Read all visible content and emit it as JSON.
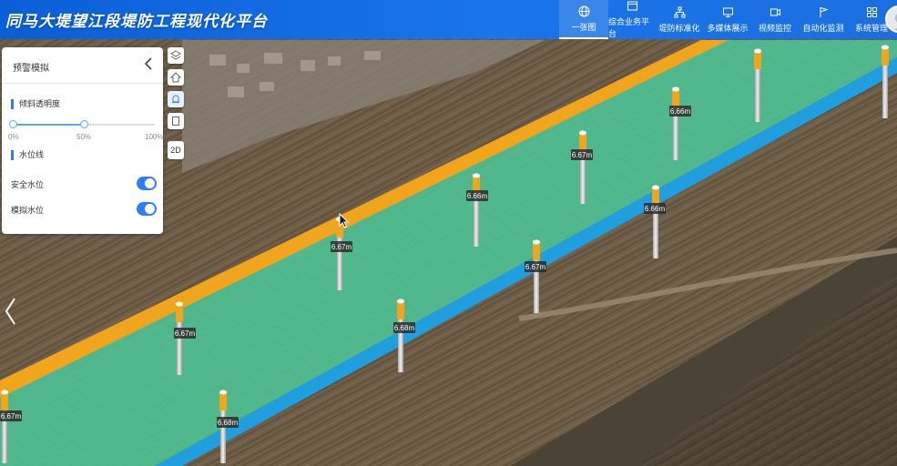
{
  "app": {
    "title": "同马大堤望江段堤防工程现代化平台"
  },
  "nav": {
    "items": [
      {
        "label": "一张图",
        "icon": "globe-icon",
        "active": true
      },
      {
        "label": "综合业务平台",
        "icon": "window-icon",
        "active": false
      },
      {
        "label": "堤防标准化",
        "icon": "hierarchy-icon",
        "active": false
      },
      {
        "label": "多媒体展示",
        "icon": "monitor-icon",
        "active": false
      },
      {
        "label": "视频监控",
        "icon": "video-icon",
        "active": false
      },
      {
        "label": "自动化监测",
        "icon": "flag-icon",
        "active": false
      },
      {
        "label": "系统管理",
        "icon": "grid-icon",
        "active": false
      }
    ]
  },
  "panel": {
    "title": "预警模拟",
    "transparency": {
      "label": "倾斜透明度",
      "value": 0.5,
      "tick_min": "0%",
      "tick_mid": "50%",
      "tick_max": "100%"
    },
    "waterline": {
      "label": "水位线",
      "toggles": [
        {
          "label": "安全水位",
          "on": true
        },
        {
          "label": "模拟水位",
          "on": true
        }
      ]
    }
  },
  "toolbar": {
    "mode_2d": "2D"
  },
  "markers": [
    {
      "label": "6.66m"
    },
    {
      "label": "6.67m"
    },
    {
      "label": "6.66m"
    },
    {
      "label": "6.66m"
    },
    {
      "label": "6.67m"
    },
    {
      "label": "6.67m"
    },
    {
      "label": "6.67m"
    },
    {
      "label": "6.68m"
    },
    {
      "label": "6.68m"
    },
    {
      "label": "6.67m"
    }
  ],
  "colors": {
    "header": "#1a6fe6",
    "safe_band": "#f0a51c",
    "water_band": "#1f9ee0",
    "water_surface": "#4cc79a",
    "accent": "#2f7df6"
  }
}
